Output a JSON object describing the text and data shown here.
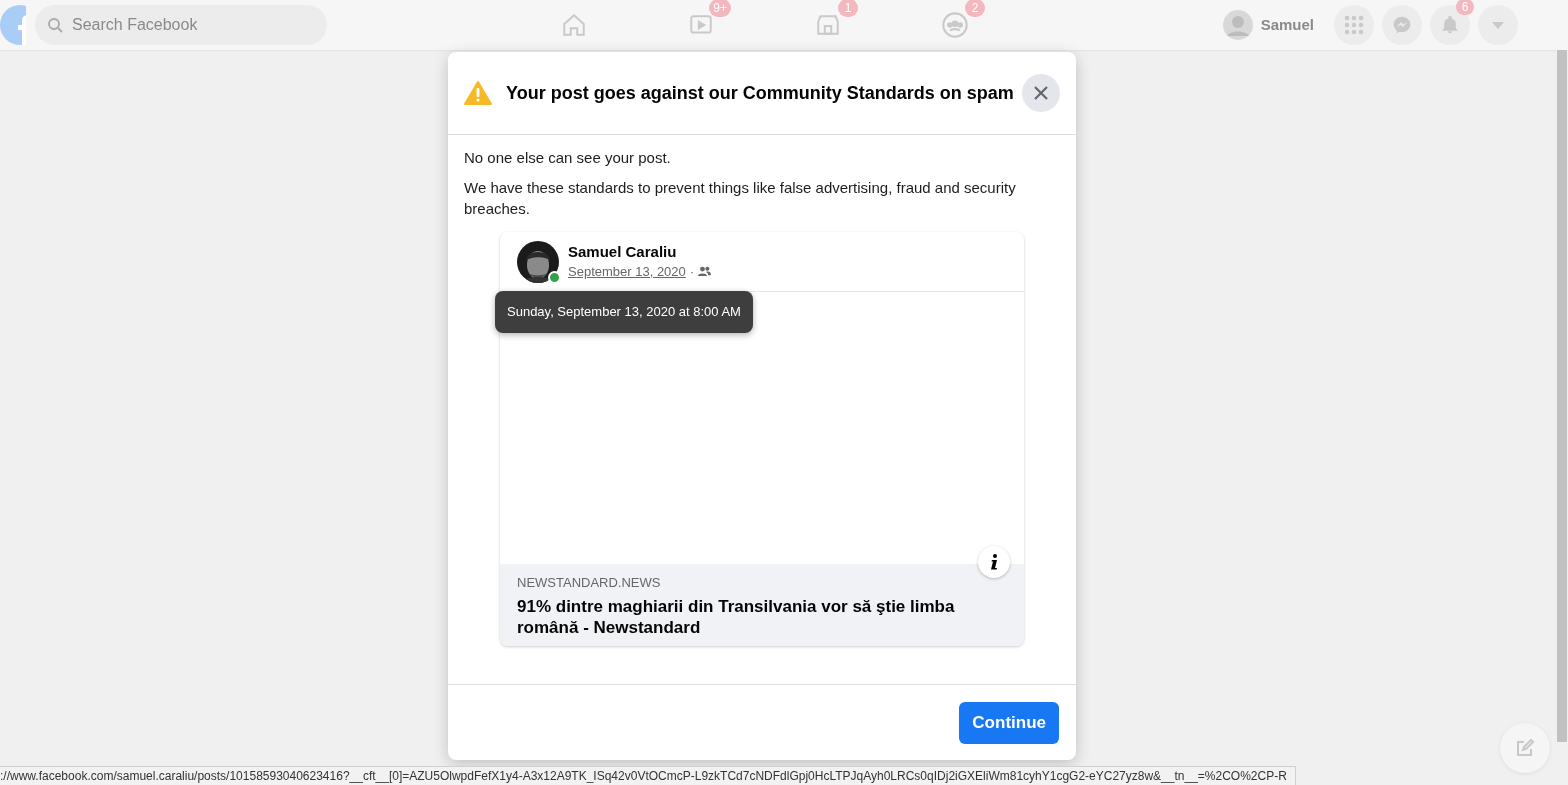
{
  "top_bar": {
    "search": {
      "placeholder": "Search Facebook"
    },
    "nav": [
      {
        "kind": "home"
      },
      {
        "kind": "watch",
        "badge": "9+"
      },
      {
        "kind": "marketplace",
        "badge": "1"
      },
      {
        "kind": "groups",
        "badge": "2"
      }
    ],
    "profile": {
      "name": "Samuel"
    },
    "actions": [
      {
        "kind": "menu"
      },
      {
        "kind": "messenger"
      },
      {
        "kind": "notifications",
        "badge": "6"
      },
      {
        "kind": "account"
      }
    ]
  },
  "dialog": {
    "title": "Your post goes against our Community Standards on spam",
    "paragraphs": [
      "No one else can see your post.",
      "We have these standards to prevent things like false advertising, fraud and security breaches."
    ],
    "post": {
      "author": "Samuel Caraliu",
      "online": true,
      "date": "September 13, 2020",
      "separator": "·",
      "tooltip": "Sunday, September 13, 2020 at 8:00 AM",
      "link": {
        "domain": "NEWSTANDARD.NEWS",
        "title": "91% dintre maghiarii din Transilvania vor să ştie limba română - Newstandard"
      }
    },
    "button": "Continue"
  },
  "status_url": "://www.facebook.com/samuel.caraliu/posts/10158593040623416?__cft__[0]=AZU5OlwpdFefX1y4-A3x12A9TK_ISq42v0VtOCmcP-L9zkTCd7cNDFdlGpj0HcLTPJqAyh0LRCs0qIDj2iGXEliWm81cyhY1cgG2-eYC27yz8w&__tn__=%2CO%2CP-R"
}
